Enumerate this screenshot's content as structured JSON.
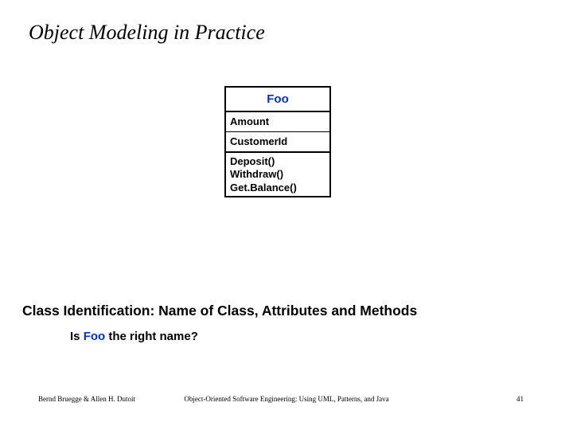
{
  "title": "Object Modeling in Practice",
  "uml": {
    "class_name": "Foo",
    "attributes": [
      "Amount",
      "CustomerId"
    ],
    "operations": [
      "Deposit()",
      "Withdraw()",
      "Get.Balance()"
    ]
  },
  "subtitle": "Class Identification: Name of Class, Attributes and Methods",
  "question_prefix": "Is ",
  "question_highlight": "Foo",
  "question_suffix": " the right name?",
  "footer": {
    "left": "Bernd Bruegge & Allen H. Dutoit",
    "center": "Object-Oriented Software Engineering: Using UML, Patterns, and Java",
    "right": "41"
  }
}
